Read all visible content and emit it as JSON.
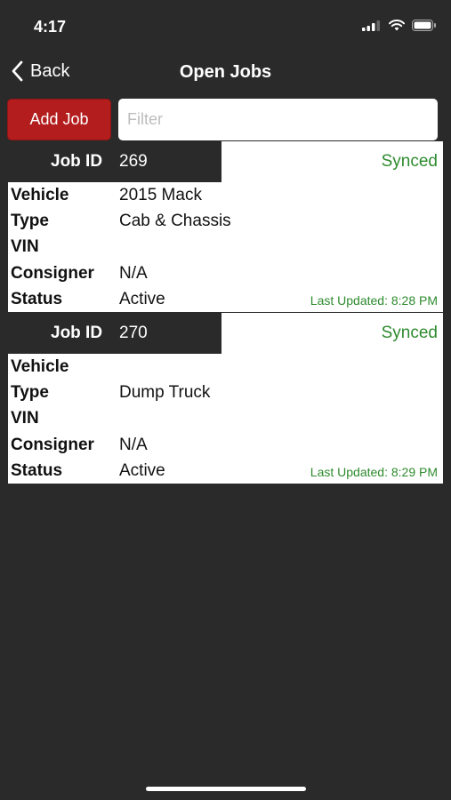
{
  "status_bar": {
    "time": "4:17"
  },
  "nav": {
    "back_label": "Back",
    "title": "Open Jobs"
  },
  "toolbar": {
    "add_job_label": "Add Job",
    "filter_placeholder": "Filter"
  },
  "colors": {
    "accent_red": "#b31d1d",
    "synced_green": "#2e8b2e",
    "background": "#2a2a2a"
  },
  "jobs": [
    {
      "id_label": "Job ID",
      "id": "269",
      "sync_status": "Synced",
      "fields": [
        {
          "label": "Vehicle",
          "value": "2015 Mack"
        },
        {
          "label": "Type",
          "value": "Cab & Chassis"
        },
        {
          "label": "VIN",
          "value": ""
        },
        {
          "label": "Consigner",
          "value": "N/A"
        },
        {
          "label": "Status",
          "value": "Active"
        }
      ],
      "last_updated": "Last Updated: 8:28 PM"
    },
    {
      "id_label": "Job ID",
      "id": "270",
      "sync_status": "Synced",
      "fields": [
        {
          "label": "Vehicle",
          "value": ""
        },
        {
          "label": "Type",
          "value": "Dump Truck"
        },
        {
          "label": "VIN",
          "value": ""
        },
        {
          "label": "Consigner",
          "value": "N/A"
        },
        {
          "label": "Status",
          "value": "Active"
        }
      ],
      "last_updated": "Last Updated: 8:29 PM"
    }
  ]
}
